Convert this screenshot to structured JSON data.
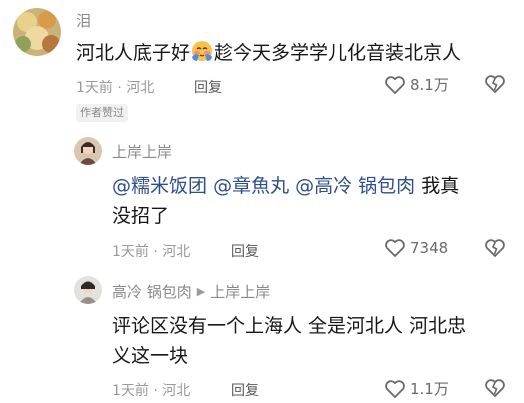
{
  "comments": [
    {
      "author": "泪",
      "text_before": "河北人底子好",
      "emoji_icon": "blushing-face-emoji",
      "text_after": "趁今天多学学儿化音装北京人",
      "time": "1天前",
      "location": "河北",
      "reply_label": "回复",
      "likes": "8.1万",
      "author_liked_badge": "作者赞过"
    },
    {
      "author": "上岸上岸",
      "mentions": [
        "@糯米饭团",
        "@章魚丸",
        "@高冷 锅包肉"
      ],
      "text": "我真没招了",
      "text_line1_tail": "我真",
      "text_line2": "没招了",
      "time": "1天前",
      "location": "河北",
      "reply_label": "回复",
      "likes": "7348"
    },
    {
      "author": "高冷 锅包肉",
      "reply_to": "上岸上岸",
      "text_line1": "评论区没有一个上海人 全是河北人 河北忠",
      "text_line2": "义这一块",
      "time": "1天前",
      "location": "河北",
      "reply_label": "回复",
      "likes": "1.1万"
    }
  ],
  "separator": "·",
  "icons": {
    "like": "heart-outline-icon",
    "dislike": "broken-heart-icon",
    "reply_arrow": "caret-right-icon"
  }
}
